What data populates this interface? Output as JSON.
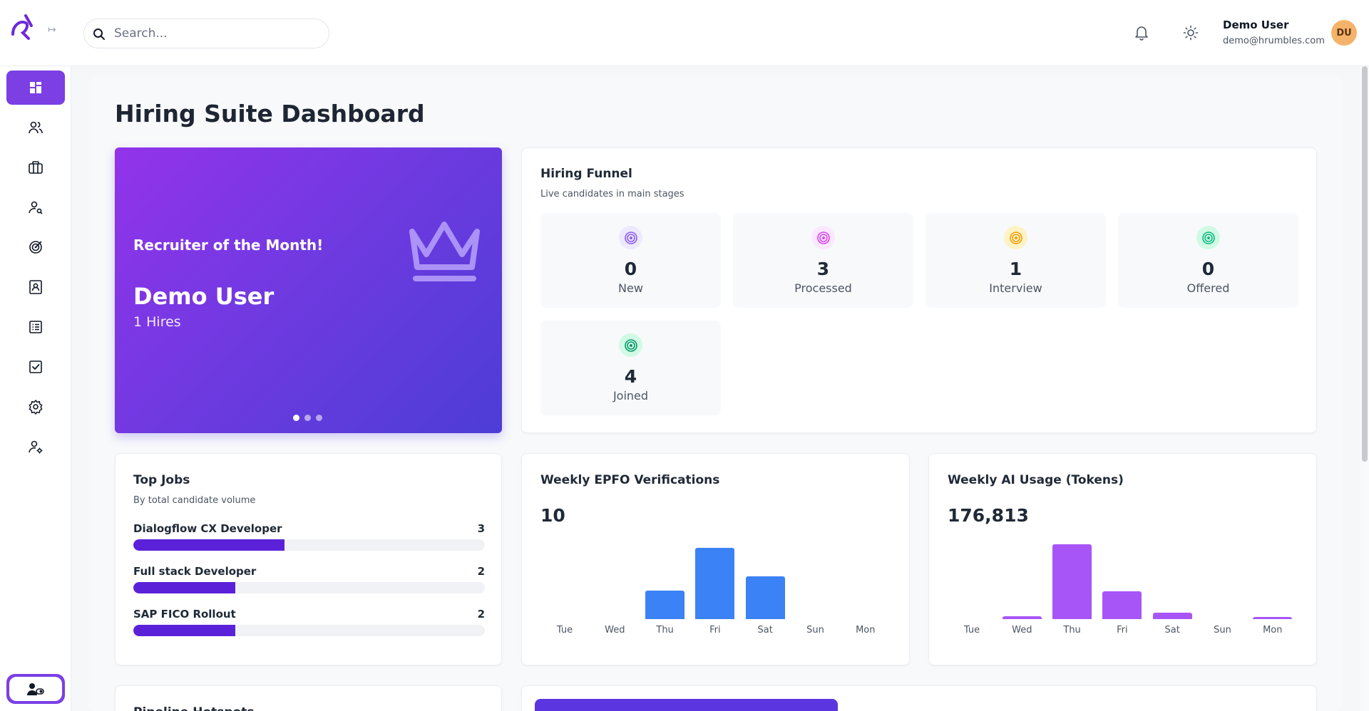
{
  "header": {
    "search_placeholder": "Search...",
    "user_name": "Demo User",
    "user_email": "demo@hrumbles.com",
    "avatar_initials": "DU"
  },
  "sidebar": {
    "items": [
      {
        "icon": "dashboard-icon",
        "active": true
      },
      {
        "icon": "users-icon"
      },
      {
        "icon": "briefcase-icon"
      },
      {
        "icon": "user-search-icon"
      },
      {
        "icon": "target-icon"
      },
      {
        "icon": "contact-book-icon"
      },
      {
        "icon": "list-icon"
      },
      {
        "icon": "checklist-icon"
      },
      {
        "icon": "settings-icon"
      },
      {
        "icon": "user-settings-icon"
      }
    ],
    "bottom_icon": "user-toggle-icon"
  },
  "page": {
    "title": "Hiring Suite Dashboard"
  },
  "hero": {
    "subtitle": "Recruiter of the Month!",
    "name": "Demo User",
    "hires": "1 Hires",
    "icon": "crown-icon",
    "slides": 3,
    "active_slide": 0
  },
  "funnel": {
    "title": "Hiring Funnel",
    "subtitle": "Live candidates in main stages",
    "stages": [
      {
        "count": "0",
        "label": "New",
        "color": "#8b5cf6",
        "bg": "#ede9fe"
      },
      {
        "count": "3",
        "label": "Processed",
        "color": "#d946ef",
        "bg": "#fae8ff"
      },
      {
        "count": "1",
        "label": "Interview",
        "color": "#f59e0b",
        "bg": "#fef3c7"
      },
      {
        "count": "0",
        "label": "Offered",
        "color": "#10b981",
        "bg": "#d1fae5"
      },
      {
        "count": "4",
        "label": "Joined",
        "color": "#059669",
        "bg": "#d1fae5"
      }
    ]
  },
  "top_jobs": {
    "title": "Top Jobs",
    "subtitle": "By total candidate volume",
    "jobs": [
      {
        "title": "Dialogflow CX Developer",
        "count": "3",
        "fraction": 0.43
      },
      {
        "title": "Full stack Developer",
        "count": "2",
        "fraction": 0.29
      },
      {
        "title": "SAP FICO Rollout",
        "count": "2",
        "fraction": 0.29
      }
    ]
  },
  "epfo": {
    "title": "Weekly EPFO Verifications",
    "total": "10",
    "color": "#3b82f6"
  },
  "ai_usage": {
    "title": "Weekly AI Usage (Tokens)",
    "total": "176,813",
    "color": "#a855f7"
  },
  "partial": {
    "next_card_title": "Pipeline Hotspots"
  },
  "chart_data": [
    {
      "type": "bar",
      "title": "Weekly EPFO Verifications",
      "categories": [
        "Tue",
        "Wed",
        "Thu",
        "Fri",
        "Sat",
        "Sun",
        "Mon"
      ],
      "values": [
        0,
        0,
        2,
        5,
        3,
        0,
        0
      ],
      "ylim": [
        0,
        5.5
      ]
    },
    {
      "type": "bar",
      "title": "Weekly AI Usage (Tokens)",
      "categories": [
        "Tue",
        "Wed",
        "Thu",
        "Fri",
        "Sat",
        "Sun",
        "Mon"
      ],
      "values": [
        0,
        4000,
        115000,
        43000,
        10000,
        0,
        2000
      ],
      "ylim": [
        0,
        120000
      ]
    }
  ]
}
